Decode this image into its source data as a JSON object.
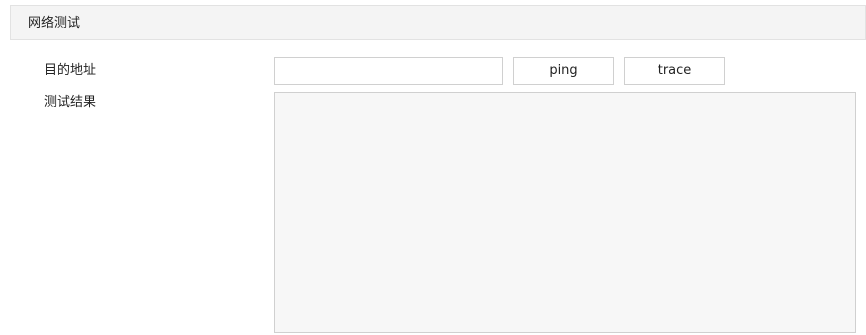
{
  "section": {
    "title": "网络测试"
  },
  "form": {
    "target_label": "目的地址",
    "target_value": "",
    "target_placeholder": "",
    "result_label": "测试结果",
    "result_value": ""
  },
  "buttons": {
    "ping_label": "ping",
    "trace_label": "trace"
  }
}
